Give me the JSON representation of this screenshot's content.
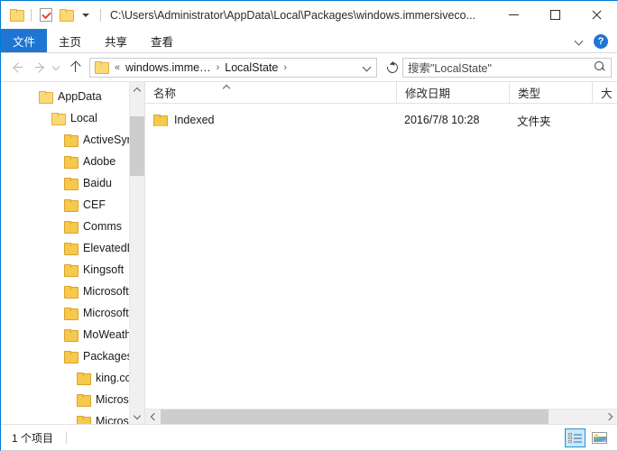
{
  "window": {
    "title": "C:\\Users\\Administrator\\AppData\\Local\\Packages\\windows.immersiveco...",
    "accent_color": "#0078d7"
  },
  "quick_access_toolbar": {
    "items": [
      {
        "name": "explorer-folder-icon",
        "label": ""
      },
      {
        "name": "properties-icon",
        "label": ""
      },
      {
        "name": "new-folder-icon",
        "label": ""
      },
      {
        "name": "customize-qat-caret",
        "label": ""
      }
    ]
  },
  "window_controls": {
    "minimize": "—",
    "maximize": "□",
    "close": "✕"
  },
  "ribbon": {
    "tabs": [
      {
        "label": "文件",
        "active": true
      },
      {
        "label": "主页",
        "active": false
      },
      {
        "label": "共享",
        "active": false
      },
      {
        "label": "查看",
        "active": false
      }
    ],
    "expand_label": "",
    "help_label": "?"
  },
  "navigation": {
    "back_label": "",
    "forward_label": "",
    "history_label": "",
    "up_label": "",
    "refresh_label": ""
  },
  "breadcrumb": {
    "overflow": "«",
    "segments": [
      {
        "label": "windows.imme…"
      },
      {
        "label": "LocalState"
      }
    ],
    "separator": "›",
    "trailing_separator": "›"
  },
  "search": {
    "placeholder": "搜索\"LocalState\"",
    "value": ""
  },
  "tree": {
    "items": [
      {
        "label": "AppData",
        "level": 0
      },
      {
        "label": "Local",
        "level": 1
      },
      {
        "label": "ActiveSync",
        "level": 2
      },
      {
        "label": "Adobe",
        "level": 2
      },
      {
        "label": "Baidu",
        "level": 2
      },
      {
        "label": "CEF",
        "level": 2
      },
      {
        "label": "Comms",
        "level": 2
      },
      {
        "label": "ElevatedDi",
        "level": 2
      },
      {
        "label": "Kingsoft",
        "level": 2
      },
      {
        "label": "Microsoft",
        "level": 2
      },
      {
        "label": "MicrosoftE",
        "level": 2
      },
      {
        "label": "MoWeathe",
        "level": 2
      },
      {
        "label": "Packages",
        "level": 2
      },
      {
        "label": "king.com",
        "level": 3
      },
      {
        "label": "Microsoft",
        "level": 3
      },
      {
        "label": "Microsoft",
        "level": 3
      }
    ]
  },
  "file_list": {
    "columns": [
      {
        "label": "名称",
        "sorted": true
      },
      {
        "label": "修改日期",
        "sorted": false
      },
      {
        "label": "类型",
        "sorted": false
      },
      {
        "label": "大",
        "sorted": false
      }
    ],
    "rows": [
      {
        "name": "Indexed",
        "date_modified": "2016/7/8 10:28",
        "type": "文件夹",
        "size": ""
      }
    ]
  },
  "status_bar": {
    "item_count_text": "1 个项目"
  },
  "view_buttons": [
    {
      "name": "details-view-button",
      "selected": true
    },
    {
      "name": "large-icons-view-button",
      "selected": false
    }
  ]
}
